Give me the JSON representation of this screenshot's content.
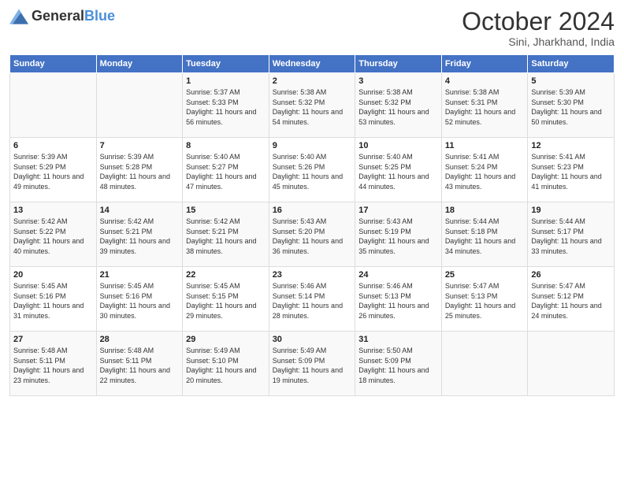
{
  "logo": {
    "text_general": "General",
    "text_blue": "Blue"
  },
  "header": {
    "month": "October 2024",
    "location": "Sini, Jharkhand, India"
  },
  "days_of_week": [
    "Sunday",
    "Monday",
    "Tuesday",
    "Wednesday",
    "Thursday",
    "Friday",
    "Saturday"
  ],
  "weeks": [
    [
      {
        "day": "",
        "info": ""
      },
      {
        "day": "",
        "info": ""
      },
      {
        "day": "1",
        "info": "Sunrise: 5:37 AM\nSunset: 5:33 PM\nDaylight: 11 hours and 56 minutes."
      },
      {
        "day": "2",
        "info": "Sunrise: 5:38 AM\nSunset: 5:32 PM\nDaylight: 11 hours and 54 minutes."
      },
      {
        "day": "3",
        "info": "Sunrise: 5:38 AM\nSunset: 5:32 PM\nDaylight: 11 hours and 53 minutes."
      },
      {
        "day": "4",
        "info": "Sunrise: 5:38 AM\nSunset: 5:31 PM\nDaylight: 11 hours and 52 minutes."
      },
      {
        "day": "5",
        "info": "Sunrise: 5:39 AM\nSunset: 5:30 PM\nDaylight: 11 hours and 50 minutes."
      }
    ],
    [
      {
        "day": "6",
        "info": "Sunrise: 5:39 AM\nSunset: 5:29 PM\nDaylight: 11 hours and 49 minutes."
      },
      {
        "day": "7",
        "info": "Sunrise: 5:39 AM\nSunset: 5:28 PM\nDaylight: 11 hours and 48 minutes."
      },
      {
        "day": "8",
        "info": "Sunrise: 5:40 AM\nSunset: 5:27 PM\nDaylight: 11 hours and 47 minutes."
      },
      {
        "day": "9",
        "info": "Sunrise: 5:40 AM\nSunset: 5:26 PM\nDaylight: 11 hours and 45 minutes."
      },
      {
        "day": "10",
        "info": "Sunrise: 5:40 AM\nSunset: 5:25 PM\nDaylight: 11 hours and 44 minutes."
      },
      {
        "day": "11",
        "info": "Sunrise: 5:41 AM\nSunset: 5:24 PM\nDaylight: 11 hours and 43 minutes."
      },
      {
        "day": "12",
        "info": "Sunrise: 5:41 AM\nSunset: 5:23 PM\nDaylight: 11 hours and 41 minutes."
      }
    ],
    [
      {
        "day": "13",
        "info": "Sunrise: 5:42 AM\nSunset: 5:22 PM\nDaylight: 11 hours and 40 minutes."
      },
      {
        "day": "14",
        "info": "Sunrise: 5:42 AM\nSunset: 5:21 PM\nDaylight: 11 hours and 39 minutes."
      },
      {
        "day": "15",
        "info": "Sunrise: 5:42 AM\nSunset: 5:21 PM\nDaylight: 11 hours and 38 minutes."
      },
      {
        "day": "16",
        "info": "Sunrise: 5:43 AM\nSunset: 5:20 PM\nDaylight: 11 hours and 36 minutes."
      },
      {
        "day": "17",
        "info": "Sunrise: 5:43 AM\nSunset: 5:19 PM\nDaylight: 11 hours and 35 minutes."
      },
      {
        "day": "18",
        "info": "Sunrise: 5:44 AM\nSunset: 5:18 PM\nDaylight: 11 hours and 34 minutes."
      },
      {
        "day": "19",
        "info": "Sunrise: 5:44 AM\nSunset: 5:17 PM\nDaylight: 11 hours and 33 minutes."
      }
    ],
    [
      {
        "day": "20",
        "info": "Sunrise: 5:45 AM\nSunset: 5:16 PM\nDaylight: 11 hours and 31 minutes."
      },
      {
        "day": "21",
        "info": "Sunrise: 5:45 AM\nSunset: 5:16 PM\nDaylight: 11 hours and 30 minutes."
      },
      {
        "day": "22",
        "info": "Sunrise: 5:45 AM\nSunset: 5:15 PM\nDaylight: 11 hours and 29 minutes."
      },
      {
        "day": "23",
        "info": "Sunrise: 5:46 AM\nSunset: 5:14 PM\nDaylight: 11 hours and 28 minutes."
      },
      {
        "day": "24",
        "info": "Sunrise: 5:46 AM\nSunset: 5:13 PM\nDaylight: 11 hours and 26 minutes."
      },
      {
        "day": "25",
        "info": "Sunrise: 5:47 AM\nSunset: 5:13 PM\nDaylight: 11 hours and 25 minutes."
      },
      {
        "day": "26",
        "info": "Sunrise: 5:47 AM\nSunset: 5:12 PM\nDaylight: 11 hours and 24 minutes."
      }
    ],
    [
      {
        "day": "27",
        "info": "Sunrise: 5:48 AM\nSunset: 5:11 PM\nDaylight: 11 hours and 23 minutes."
      },
      {
        "day": "28",
        "info": "Sunrise: 5:48 AM\nSunset: 5:11 PM\nDaylight: 11 hours and 22 minutes."
      },
      {
        "day": "29",
        "info": "Sunrise: 5:49 AM\nSunset: 5:10 PM\nDaylight: 11 hours and 20 minutes."
      },
      {
        "day": "30",
        "info": "Sunrise: 5:49 AM\nSunset: 5:09 PM\nDaylight: 11 hours and 19 minutes."
      },
      {
        "day": "31",
        "info": "Sunrise: 5:50 AM\nSunset: 5:09 PM\nDaylight: 11 hours and 18 minutes."
      },
      {
        "day": "",
        "info": ""
      },
      {
        "day": "",
        "info": ""
      }
    ]
  ]
}
